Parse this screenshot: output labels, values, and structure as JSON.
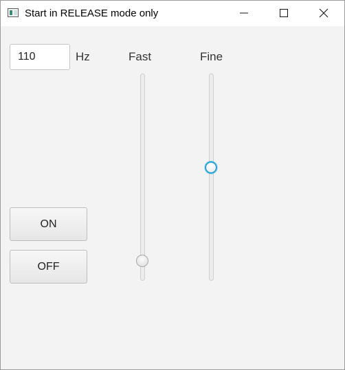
{
  "window": {
    "title": "Start in RELEASE mode only",
    "icon": "app-window-icon",
    "controls": [
      "minimize-icon",
      "maximize-icon",
      "close-icon"
    ]
  },
  "frequency": {
    "value": "110",
    "unit": "Hz"
  },
  "sliders": {
    "fast": {
      "label": "Fast",
      "value_fraction": 0.05,
      "focused": false
    },
    "fine": {
      "label": "Fine",
      "value_fraction": 0.55,
      "focused": true
    }
  },
  "buttons": {
    "on": "ON",
    "off": "OFF"
  },
  "colors": {
    "background": "#f3f3f3",
    "focus_accent": "#1ea2d8"
  }
}
